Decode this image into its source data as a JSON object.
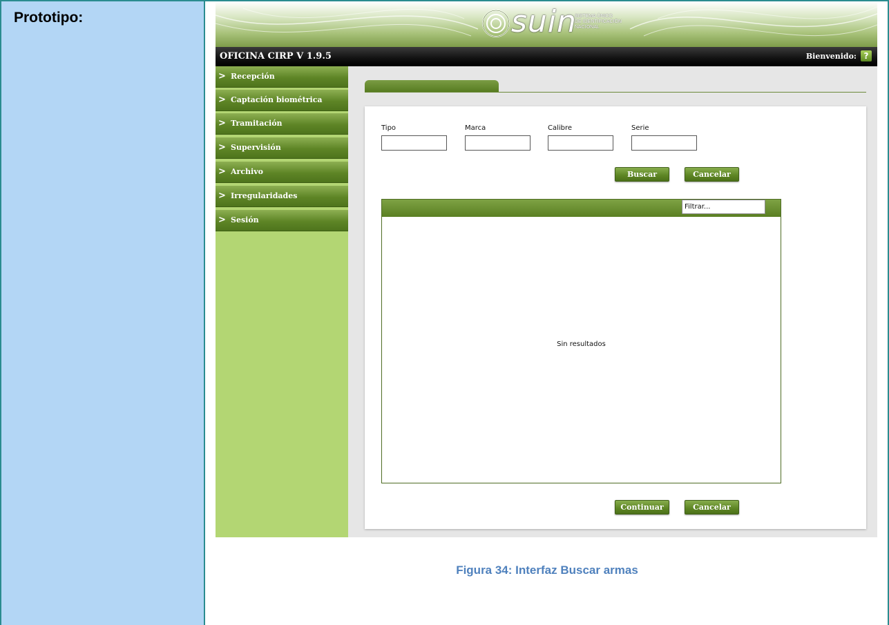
{
  "doc": {
    "label": "Prototipo:",
    "caption": "Figura 34: Interfaz Buscar armas"
  },
  "header": {
    "logo_word": "suin",
    "logo_sub": [
      "SISTEMA ÚNICO",
      "DE IDENTIFICACIÓN",
      "NACIONAL"
    ],
    "app_title": "OFICINA CIRP V 1.9.5",
    "welcome": "Bienvenido:",
    "help_icon": "?"
  },
  "sidebar": {
    "items": [
      {
        "label": "Recepción",
        "icon": "chevron-right-icon"
      },
      {
        "label": "Captación biométrica",
        "icon": "chevron-right-icon"
      },
      {
        "label": "Tramitación",
        "icon": "chevron-right-icon"
      },
      {
        "label": "Supervisión",
        "icon": "chevron-right-icon"
      },
      {
        "label": "Archivo",
        "icon": "chevron-right-icon"
      },
      {
        "label": "Irregularidades",
        "icon": "chevron-right-icon"
      },
      {
        "label": "Sesión",
        "icon": "chevron-right-icon"
      }
    ]
  },
  "search": {
    "fields": [
      {
        "label": "Tipo",
        "value": ""
      },
      {
        "label": "Marca",
        "value": ""
      },
      {
        "label": "Calibre",
        "value": ""
      },
      {
        "label": "Serie",
        "value": ""
      }
    ],
    "search_button": "Buscar",
    "cancel_button": "Cancelar"
  },
  "results": {
    "filter_value": "Filtrar...",
    "empty_message": "Sin resultados"
  },
  "footer": {
    "continue_button": "Continuar",
    "cancel_button": "Cancelar"
  },
  "colors": {
    "accent_green": "#5c8423",
    "sidebar_bg": "#b3d673",
    "cell_blue": "#b3d6f5",
    "caption_blue": "#4f81bd"
  }
}
